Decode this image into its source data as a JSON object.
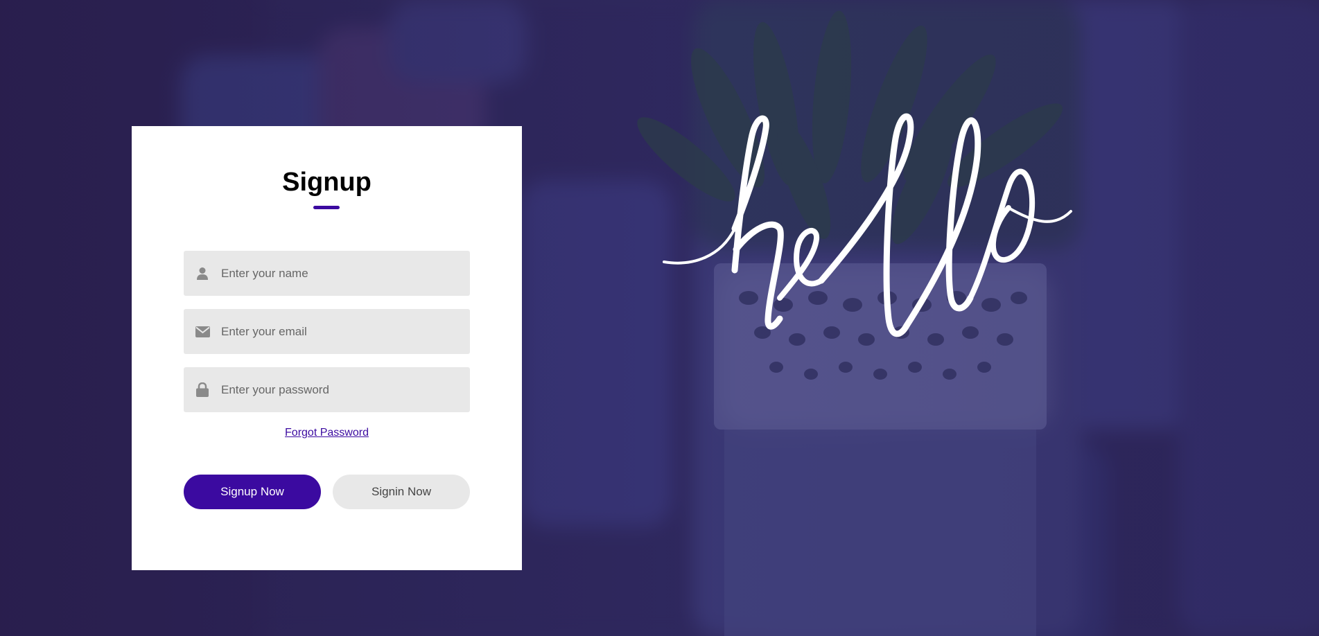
{
  "signup_form": {
    "title": "Signup",
    "fields": {
      "name": {
        "placeholder": "Enter your name",
        "value": "",
        "icon": "user-icon"
      },
      "email": {
        "placeholder": "Enter your email",
        "value": "",
        "icon": "envelope-icon"
      },
      "password": {
        "placeholder": "Enter your password",
        "value": "",
        "icon": "lock-icon"
      }
    },
    "forgot_password_label": "Forgot Password",
    "signup_button_label": "Signup Now",
    "signin_button_label": "Signin Now"
  },
  "hero": {
    "script_text": "hello"
  },
  "colors": {
    "accent": "#3b0aa0",
    "field_background": "#e8e8e8",
    "card_background": "#ffffff",
    "page_overlay": "#2e2650"
  }
}
